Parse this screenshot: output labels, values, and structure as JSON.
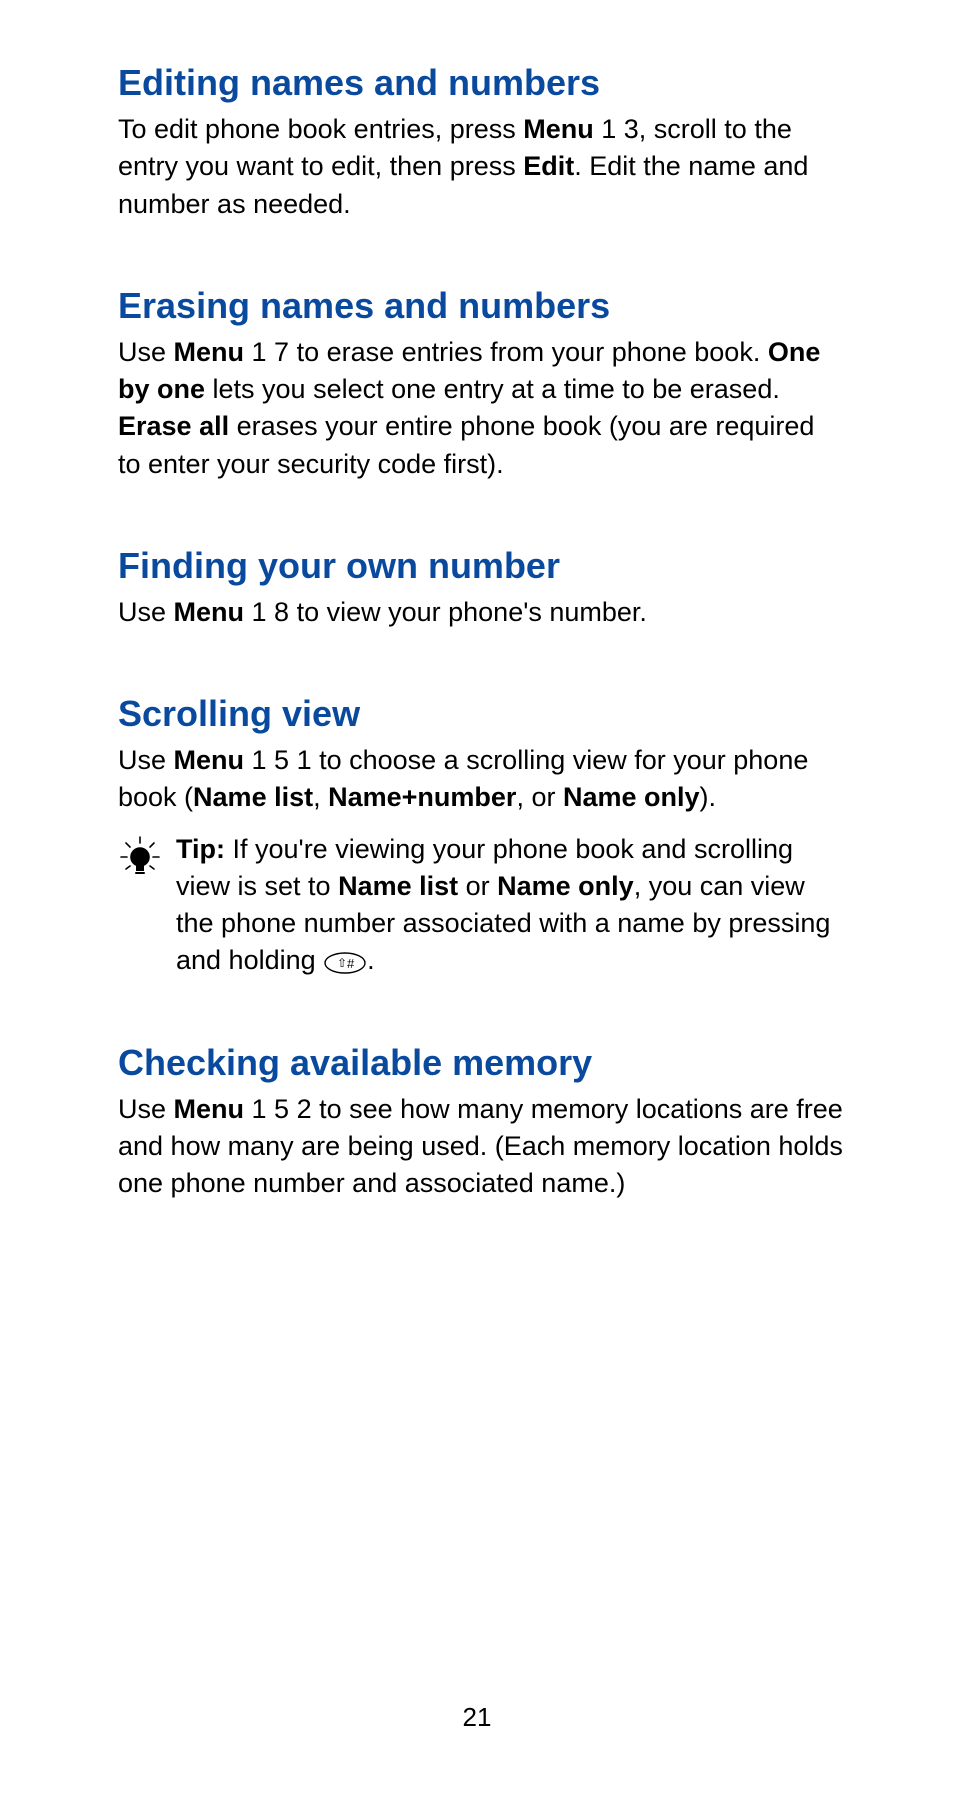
{
  "page_number": "21",
  "sections": {
    "editing": {
      "heading": "Editing names and numbers",
      "para": {
        "t1": "To edit phone book entries, press ",
        "b1": "Menu",
        "t2": " 1 3, scroll to the entry you want to edit, then press ",
        "b2": "Edit",
        "t3": ". Edit the name and number as needed."
      }
    },
    "erasing": {
      "heading": "Erasing names and numbers",
      "para": {
        "t1": "Use ",
        "b1": "Menu",
        "t2": " 1 7 to erase entries from your phone book. ",
        "b2": "One by one",
        "t3": " lets you select one entry at a time to be erased. ",
        "b3": "Erase all",
        "t4": " erases your entire phone book (you are required to enter your security code first)."
      }
    },
    "finding": {
      "heading": "Finding your own number",
      "para": {
        "t1": "Use ",
        "b1": "Menu",
        "t2": " 1 8 to view your phone's number."
      }
    },
    "scrolling": {
      "heading": "Scrolling view",
      "para": {
        "t1": "Use ",
        "b1": "Menu",
        "t2": " 1 5 1 to choose a scrolling view for your phone book (",
        "b2": "Name list",
        "t3": ", ",
        "b3": "Name+number",
        "t4": ", or ",
        "b4": "Name only",
        "t5": ")."
      },
      "tip": {
        "label": "Tip:",
        "t1": "  If you're viewing your phone book and scrolling view is set to ",
        "b1": "Name list",
        "t2": " or ",
        "b2": "Name only",
        "t3": ", you can view the phone number associated with a name by pressing and holding ",
        "t4": "."
      }
    },
    "memory": {
      "heading": "Checking available memory",
      "para": {
        "t1": "Use ",
        "b1": "Menu",
        "t2": " 1 5 2 to see how many memory locations are free and how many are being used. (Each memory location holds one phone number and associated name.)"
      }
    }
  }
}
